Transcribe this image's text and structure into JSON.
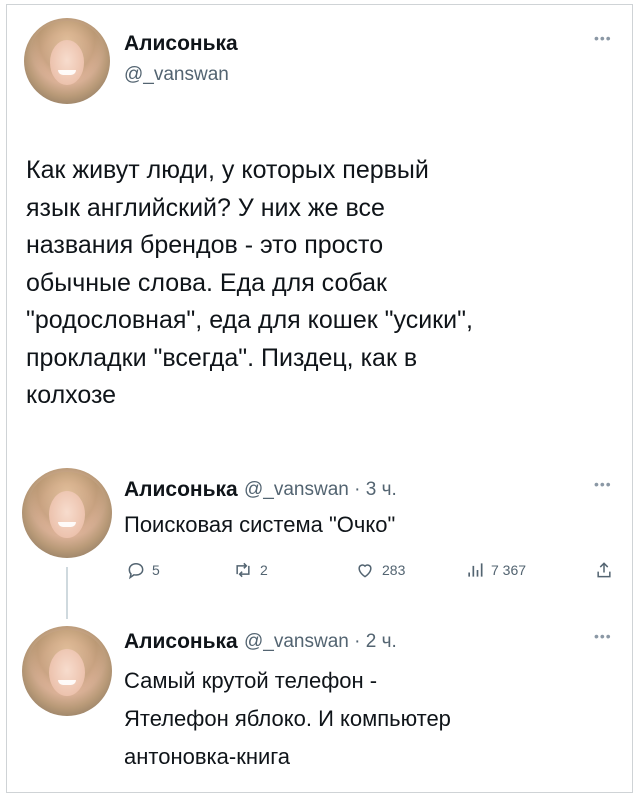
{
  "main_tweet": {
    "author_name": "Алисонька",
    "author_handle": "@_vanswan",
    "more_icon": "more-icon",
    "text_lines": [
      "Как живут люди, у которых первый",
      "язык английский? У них же все",
      "названия брендов - это просто",
      "обычные слова. Еда для собак",
      "\"родословная\", еда для кошек \"усики\",",
      "прокладки \"всегда\". Пиздец, как в",
      "колхозе"
    ]
  },
  "reply1": {
    "author_name": "Алисонька",
    "meta": "@_vanswan · 3 ч.",
    "text": "Поисковая система \"Очко\"",
    "actions": {
      "replies": "5",
      "retweets": "2",
      "likes": "283",
      "views": "7 367"
    }
  },
  "reply2": {
    "author_name": "Алисонька",
    "meta": "@_vanswan · 2 ч.",
    "text_lines": [
      "Самый крутой телефон -",
      "Ятелефон яблоко. И компьютер",
      "антоновка-книга"
    ]
  },
  "colors": {
    "text": "#0f1419",
    "muted": "#536471",
    "thread_line": "#cfd9de"
  }
}
